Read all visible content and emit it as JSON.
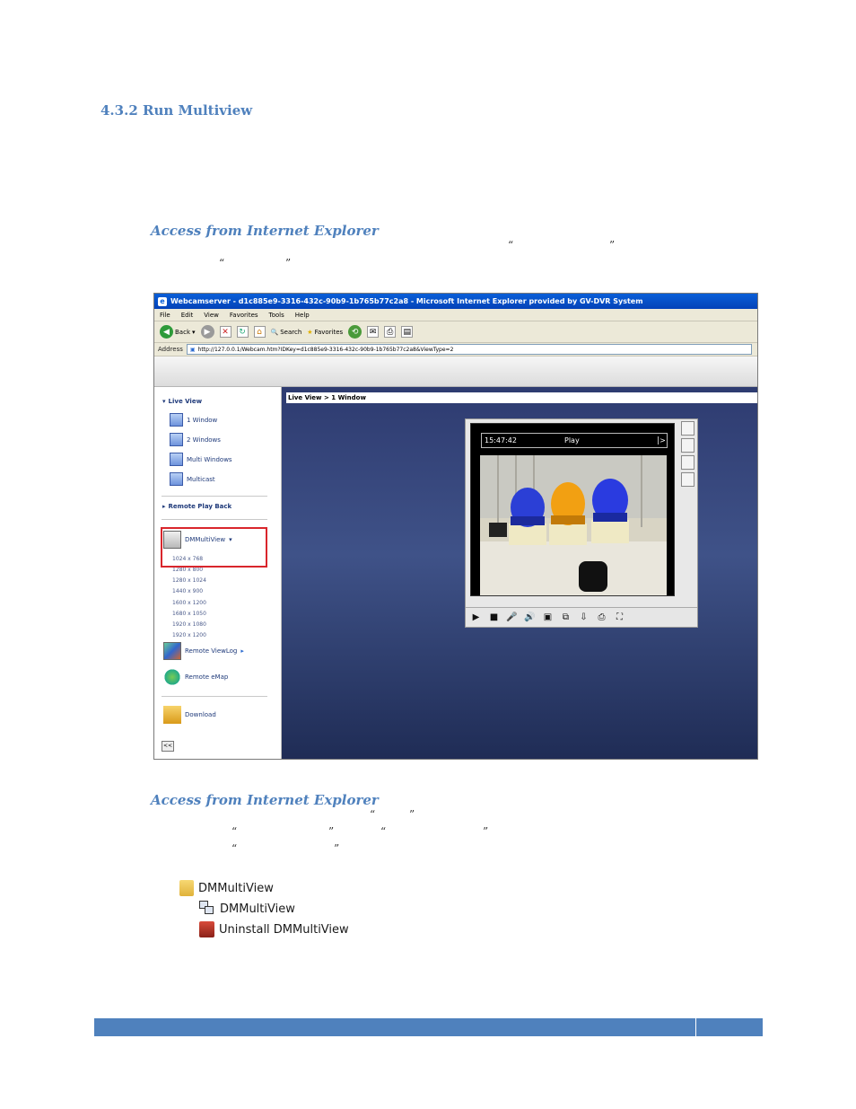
{
  "heading": "4.3.2 Run Multiview",
  "access1": {
    "title": "Access from Internet Explorer",
    "quotes_line1": [
      "“",
      "”"
    ],
    "quotes_line2": [
      "“",
      "”"
    ]
  },
  "access2": {
    "title": "Access from Internet Explorer",
    "quotes": [
      "“",
      "”",
      "“",
      "”",
      "“",
      "”",
      "“",
      "”"
    ]
  },
  "screenshot": {
    "window_title": "Webcamserver - d1c885e9-3316-432c-90b9-1b765b77c2a8 - Microsoft Internet Explorer provided by GV-DVR System",
    "menu": [
      "File",
      "Edit",
      "View",
      "Favorites",
      "Tools",
      "Help"
    ],
    "toolbar": {
      "back": "Back",
      "search": "Search",
      "favorites": "Favorites"
    },
    "address_label": "Address",
    "address": "http://127.0.0.1/Webcam.htm?IDKey=d1c885e9-3316-432c-90b9-1b765b77c2a8&ViewType=2",
    "sidebar": {
      "live_view": "Live View",
      "items": [
        "1 Window",
        "2 Windows",
        "Multi Windows",
        "Multicast"
      ],
      "remote_playback": "Remote Play Back",
      "dmmultiview": "DMMultiView",
      "resolutions": [
        "1024 x 768",
        "1280 x 800",
        "1280 x 1024",
        "1440 x 900",
        "1600 x 1200",
        "1680 x 1050",
        "1920 x 1080",
        "1920 x 1200"
      ],
      "remote_viewlog": "Remote ViewLog",
      "remote_emap": "Remote eMap",
      "download": "Download",
      "collapse": "<<"
    },
    "breadcrumb": "Live View > 1 Window",
    "viewer": {
      "time": "15:47:42",
      "status": "Play",
      "chevron": ">"
    }
  },
  "start_menu": {
    "folder": "DMMultiView",
    "app": "DMMultiView",
    "uninstall": "Uninstall DMMultiView"
  }
}
